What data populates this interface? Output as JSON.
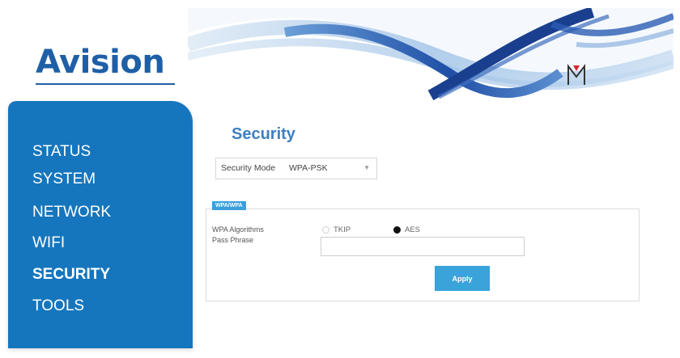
{
  "brand": {
    "logo_text": "Avision"
  },
  "sidebar": {
    "items": [
      {
        "label": "STATUS",
        "active": false
      },
      {
        "label": "SYSTEM",
        "active": false
      },
      {
        "label": "NETWORK",
        "active": false
      },
      {
        "label": "WIFI",
        "active": false
      },
      {
        "label": "SECURITY",
        "active": true
      },
      {
        "label": "TOOLS",
        "active": false
      }
    ]
  },
  "main": {
    "title": "Security",
    "security_mode": {
      "label": "Security Mode",
      "value": "WPA-PSK"
    },
    "panel": {
      "tag": "WPA/WPA",
      "algorithm_label": "WPA Algorithms",
      "algorithm_options": [
        {
          "label": "TKIP",
          "checked": false
        },
        {
          "label": "AES",
          "checked": true
        }
      ],
      "pass_phrase_label": "Pass Phrase",
      "pass_phrase_value": ""
    },
    "apply_label": "Apply"
  },
  "colors": {
    "sidebar_bg": "#1576be",
    "title": "#3f7fbf",
    "apply_bg": "#3aa3d9",
    "logo": "#1f5fa6"
  }
}
